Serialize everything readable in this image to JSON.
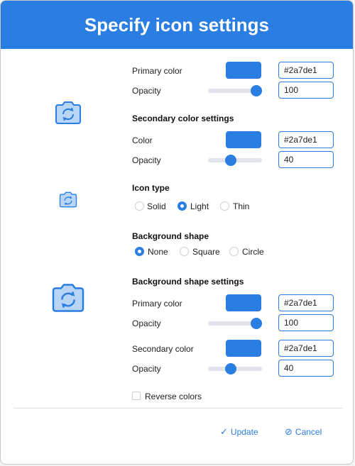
{
  "dialog": {
    "title": "Specify icon settings"
  },
  "primary": {
    "color_label": "Primary color",
    "color_hex": "#2a7de1",
    "opacity_label": "Opacity",
    "opacity_value": "100",
    "opacity_level": 1.0
  },
  "secondary": {
    "section_title": "Secondary color settings",
    "color_label": "Color",
    "color_hex": "#2a7de1",
    "opacity_label": "Opacity",
    "opacity_value": "40",
    "opacity_level": 0.4
  },
  "icon_type": {
    "section_title": "Icon type",
    "options": [
      "Solid",
      "Light",
      "Thin"
    ],
    "selected": "Light"
  },
  "background_shape": {
    "section_title": "Background shape",
    "options": [
      "None",
      "Square",
      "Circle"
    ],
    "selected": "None"
  },
  "bg_settings": {
    "section_title": "Background shape settings",
    "primary_color_label": "Primary color",
    "primary_color_hex": "#2a7de1",
    "primary_opacity_label": "Opacity",
    "primary_opacity_value": "100",
    "primary_opacity_level": 1.0,
    "secondary_color_label": "Secondary color",
    "secondary_color_hex": "#2a7de1",
    "secondary_opacity_label": "Opacity",
    "secondary_opacity_value": "40",
    "secondary_opacity_level": 0.4
  },
  "reverse_colors": {
    "label": "Reverse colors",
    "checked": false
  },
  "footer": {
    "update_label": "Update",
    "cancel_label": "Cancel"
  },
  "icons": {
    "preview": "camera-rotate-icon",
    "update": "check-icon",
    "cancel": "ban-icon"
  },
  "colors": {
    "accent": "#2a7de1"
  }
}
